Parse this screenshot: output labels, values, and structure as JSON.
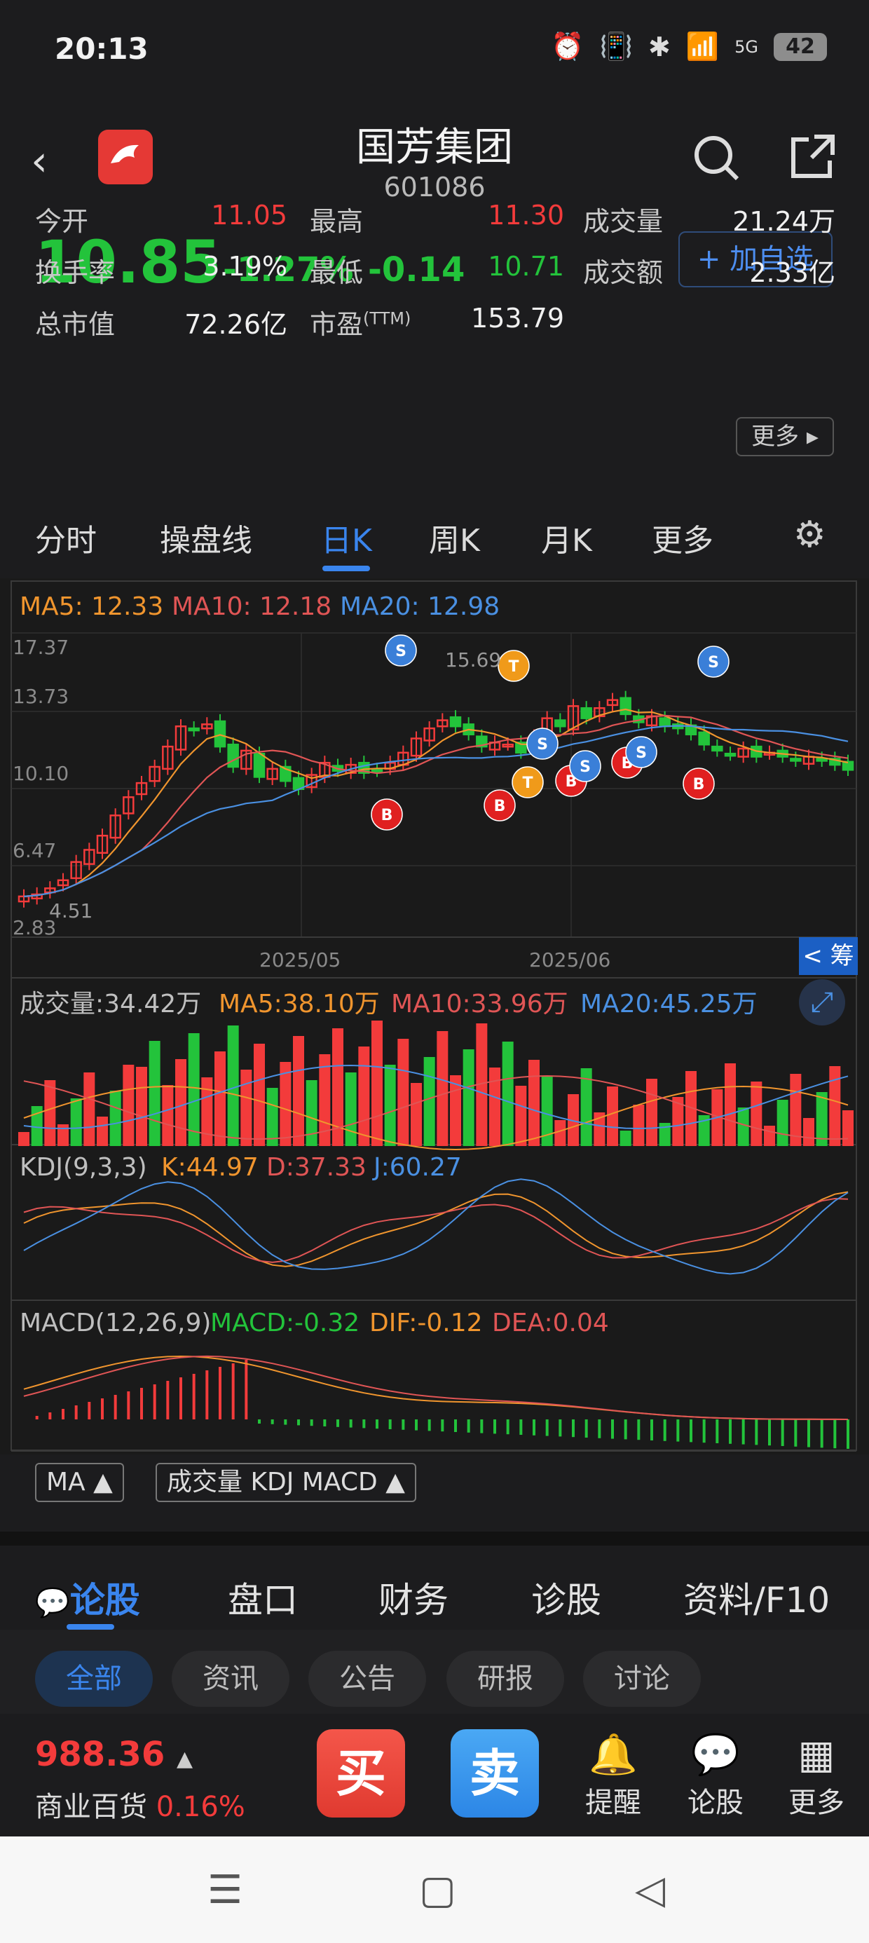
{
  "status": {
    "time": "20:13",
    "network": "5G",
    "battery": "42"
  },
  "header": {
    "stock_name": "国芳集团",
    "stock_code": "601086",
    "price": "10.85",
    "change_pct": "-1.27%",
    "change_abs": "-0.14",
    "add_watch": "+ 加自选"
  },
  "stats": [
    {
      "label": "今开",
      "value": "11.05",
      "color": "red"
    },
    {
      "label": "最高",
      "value": "11.30",
      "color": "red"
    },
    {
      "label": "成交量",
      "value": "21.24万",
      "color": "white"
    },
    {
      "label": "换手率",
      "value": "3.19%",
      "color": "white"
    },
    {
      "label": "最低",
      "value": "10.71",
      "color": "green"
    },
    {
      "label": "成交额",
      "value": "2.33亿",
      "color": "white"
    },
    {
      "label": "总市值",
      "value": "72.26亿",
      "color": "white"
    },
    {
      "label": "市盈",
      "sup": "(TTM)",
      "value": "153.79",
      "color": "white"
    }
  ],
  "more_button": "更多 ▸",
  "chart_tabs": [
    "分时",
    "操盘线",
    "日K",
    "周K",
    "月K",
    "更多"
  ],
  "chart": {
    "ma_legend": {
      "ma5": "MA5: 12.33",
      "ma10": "MA10: 12.18",
      "ma20": "MA20: 12.98"
    },
    "y_ticks": [
      "17.37",
      "13.73",
      "10.10",
      "6.47",
      "2.83"
    ],
    "price_annotations": {
      "high": "15.69",
      "low": "4.51"
    },
    "x_ticks": [
      "2025/05",
      "2025/06"
    ],
    "chou_label": "< 筹",
    "volume_legend": {
      "vol": "成交量:34.42万",
      "ma5": "MA5:38.10万",
      "ma10": "MA10:33.96万",
      "ma20": "MA20:45.25万"
    },
    "kdj_legend": {
      "name": "KDJ(9,3,3)",
      "k": "K:44.97",
      "d": "D:37.33",
      "j": "J:60.27"
    },
    "macd_legend": {
      "name": "MACD(12,26,9)",
      "macd": "MACD:-0.32",
      "dif": "DIF:-0.12",
      "dea": "DEA:0.04"
    },
    "markers": [
      "S",
      "T",
      "S",
      "B",
      "B",
      "T",
      "B",
      "S",
      "B",
      "S",
      "B",
      "S"
    ]
  },
  "chart_data": {
    "type": "candlestick",
    "y_ticks": [
      17.37,
      13.73,
      10.1,
      6.47,
      2.83
    ],
    "ylim": [
      2.83,
      17.37
    ],
    "x_ticks": [
      "2025/05",
      "2025/06"
    ],
    "closes": [
      4.6,
      4.7,
      5.0,
      5.4,
      6.3,
      6.9,
      7.6,
      8.6,
      9.5,
      10.2,
      11.0,
      12.0,
      13.0,
      12.8,
      13.1,
      12.0,
      11.0,
      11.8,
      10.5,
      10.9,
      10.3,
      9.9,
      10.6,
      11.2,
      10.8,
      11.1,
      10.7,
      10.8,
      11.2,
      11.7,
      12.4,
      12.9,
      13.3,
      13.0,
      12.6,
      12.0,
      12.2,
      12.1,
      11.7,
      12.5,
      13.4,
      13.0,
      14.0,
      13.4,
      13.9,
      14.3,
      13.6,
      13.2,
      13.5,
      13.0,
      12.9,
      12.6,
      12.1,
      11.8,
      11.6,
      11.9,
      11.5,
      11.7,
      11.5,
      11.3,
      11.5,
      11.3,
      11.1,
      10.85
    ],
    "volume_title": "成交量",
    "series": [
      {
        "name": "MA5",
        "value": 12.33
      },
      {
        "name": "MA10",
        "value": 12.18
      },
      {
        "name": "MA20",
        "value": 12.98
      }
    ]
  },
  "chart_controls": [
    "MA ▲",
    "成交量 KDJ MACD ▲"
  ],
  "bottom_tabs": [
    "论股",
    "盘口",
    "财务",
    "诊股",
    "资料/F10"
  ],
  "filters": [
    "全部",
    "资讯",
    "公告",
    "研报",
    "讨论"
  ],
  "bottom_bar": {
    "index_value": "988.36",
    "index_name": "商业百货",
    "index_pct": "0.16%",
    "buy": "买",
    "sell": "卖",
    "remind": "提醒",
    "discuss": "论股",
    "more": "更多"
  },
  "colors": {
    "up": "#f33b3b",
    "down": "#23c33b",
    "accent": "#3a85ee",
    "ma5": "#f0952e",
    "ma10": "#e05555",
    "ma20": "#4a90e2"
  }
}
